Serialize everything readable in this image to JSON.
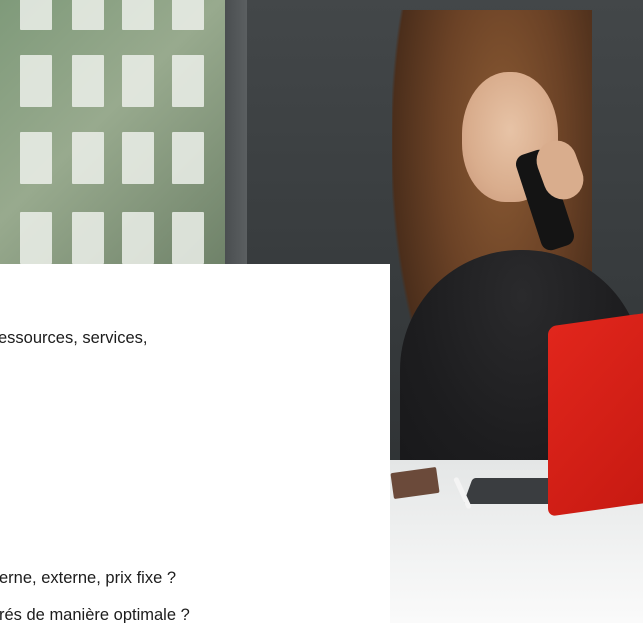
{
  "lines": [
    "essources, services,",
    "erne, externe, prix fixe ?",
    "rés de manière optimale ?"
  ],
  "colors": {
    "tablet": "#e1261c",
    "card": "#ffffff",
    "text": "#1c1c1c"
  }
}
